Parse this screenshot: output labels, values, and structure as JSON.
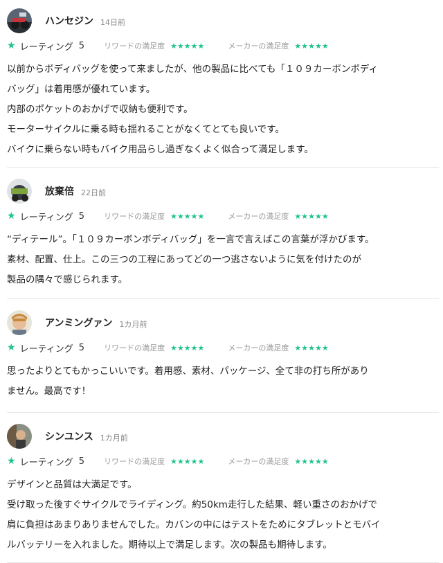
{
  "labels": {
    "rating": "レーティング",
    "reward_satisfaction": "リワードの満足度",
    "maker_satisfaction": "メーカーの満足度",
    "stars": "★★★★★"
  },
  "reviews": [
    {
      "name": "ハンセジン",
      "date": "14日前",
      "score": "5",
      "lines": [
        "以前からボディバッグを使って来ましたが、他の製品に比べても「１０９カーボンボディ",
        "バッグ」は着用感が優れています。",
        "内部のポケットのおかげで収納も便利です。",
        "モーターサイクルに乗る時も揺れることがなくてとても良いです。",
        "バイクに乗らない時もバイク用品らし過ぎなくよく似合って満足します。"
      ]
    },
    {
      "name": "放棄倍",
      "date": "22日前",
      "score": "5",
      "lines": [
        "“ディテール”。「１０９カーボンボディバッグ」を一言で言えばこの言葉が浮かびます。",
        "素材、配置、仕上。この三つの工程にあってどの一つ逃さないように気を付けたのが",
        "製品の隅々で感じられます。"
      ]
    },
    {
      "name": "アンミングァン",
      "date": "1カ月前",
      "score": "5",
      "lines": [
        "思ったよりとてもかっこいいです。着用感、素材、パッケージ、全て非の打ち所があり",
        "ません。最高です！"
      ]
    },
    {
      "name": "シンユンス",
      "date": "1カ月前",
      "score": "5",
      "lines": [
        "デザインと品質は大満足です。",
        "受け取った後すぐサイクルでライディング。約50km走行した結果、軽い重さのおかげで",
        "肩に負担はあまりありませんでした。カバンの中にはテストをためにタブレットとモバイ",
        "ルバッテリーを入れました。期待以上で満足します。次の製品も期待します。"
      ]
    }
  ]
}
